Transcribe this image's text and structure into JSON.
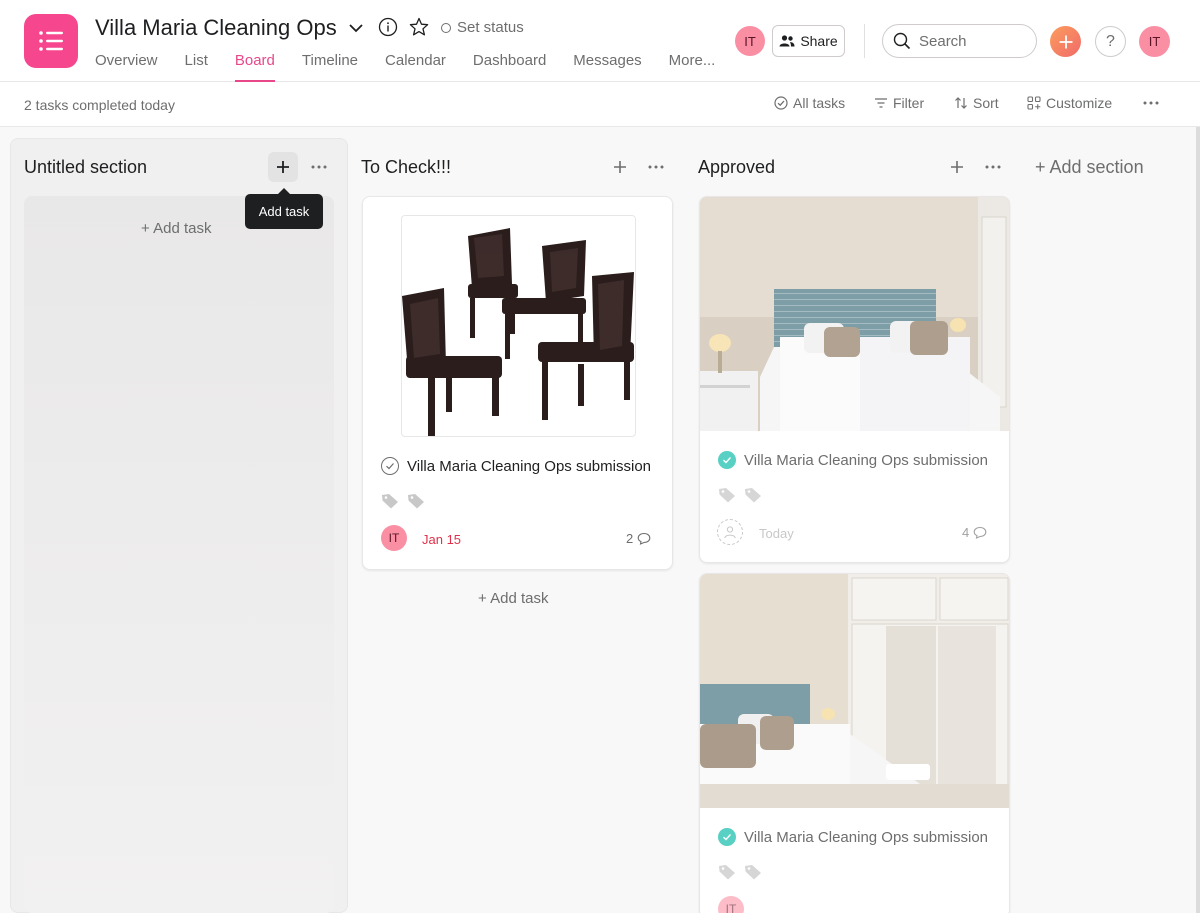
{
  "project": {
    "title": "Villa Maria Cleaning Ops",
    "set_status": "Set status"
  },
  "tabs": [
    {
      "label": "Overview"
    },
    {
      "label": "List"
    },
    {
      "label": "Board"
    },
    {
      "label": "Timeline"
    },
    {
      "label": "Calendar"
    },
    {
      "label": "Dashboard"
    },
    {
      "label": "Messages"
    },
    {
      "label": "More..."
    }
  ],
  "active_tab": "Board",
  "header": {
    "avatar_initials": "IT",
    "share_label": "Share",
    "search_placeholder": "Search",
    "help_label": "?"
  },
  "toolbar": {
    "completed_text": "2 tasks completed today",
    "all_tasks": "All tasks",
    "filter": "Filter",
    "sort": "Sort",
    "customize": "Customize"
  },
  "columns": [
    {
      "title": "Untitled section",
      "add_task": "+ Add task",
      "tooltip": "Add task"
    },
    {
      "title": "To Check!!!",
      "add_task": "+ Add task",
      "cards": [
        {
          "title": "Villa Maria Cleaning Ops submission",
          "assignee": "IT",
          "due": "Jan 15",
          "comment_count": "2",
          "image": "dining-chairs"
        }
      ]
    },
    {
      "title": "Approved",
      "cards": [
        {
          "title": "Villa Maria Cleaning Ops submission",
          "due": "Today",
          "comment_count": "4",
          "image": "bedroom-twin-beds"
        },
        {
          "title": "Villa Maria Cleaning Ops submission",
          "assignee": "IT",
          "image": "bedroom-wardrobe"
        }
      ]
    }
  ],
  "add_section": "+ Add section",
  "colors": {
    "accent": "#e8488a",
    "brand_icon": "#f6478e",
    "avatar": "#fa8fa4",
    "done_check": "#58d0c4",
    "due_red": "#e0314b"
  }
}
